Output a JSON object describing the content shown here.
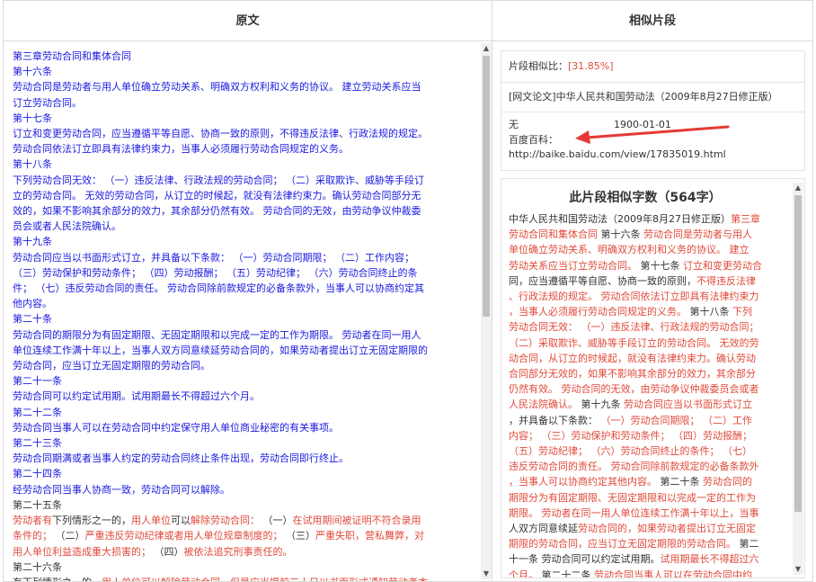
{
  "left": {
    "header": "原文",
    "lines": [
      [
        {
          "t": "第三章劳动合同和集体合同",
          "c": "blue"
        }
      ],
      [
        {
          "t": "第十六条",
          "c": "blue"
        }
      ],
      [
        {
          "t": "劳动合同是劳动者与用人单位确立劳动关系、明确双方权利和义务的协议。 建立劳动关系应当",
          "c": "blue"
        }
      ],
      [
        {
          "t": "订立劳动合同。",
          "c": "blue"
        }
      ],
      [
        {
          "t": "第十七条",
          "c": "blue"
        }
      ],
      [
        {
          "t": "订立和变更劳动合同，应当遵循平等自愿、协商一致的原则，不得违反法律、行政法规的规定。",
          "c": "blue"
        }
      ],
      [
        {
          "t": "劳动合同依法订立即具有法律约束力，当事人必须履行劳动合同规定的义务。",
          "c": "blue"
        }
      ],
      [
        {
          "t": "第十八条",
          "c": "blue"
        }
      ],
      [
        {
          "t": "下列劳动合同无效： （一）违反法律、行政法规的劳动合同； （二）采取欺诈、威胁等手段订",
          "c": "blue"
        }
      ],
      [
        {
          "t": "立的劳动合同。 无效的劳动合同，从订立的时候起，就没有法律约束力。确认劳动合同部分无",
          "c": "blue"
        }
      ],
      [
        {
          "t": "效的，如果不影响其余部分的效力，其余部分仍然有效。 劳动合同的无效，由劳动争议仲裁委",
          "c": "blue"
        }
      ],
      [
        {
          "t": "员会或者人民法院确认。",
          "c": "blue"
        }
      ],
      [
        {
          "t": "第十九条",
          "c": "blue"
        }
      ],
      [
        {
          "t": "劳动合同应当以书面形式订立，并具备以下条款： （一）劳动合同期限； （二）工作内容；",
          "c": "blue"
        }
      ],
      [
        {
          "t": "（三）劳动保护和劳动条件； （四）劳动报酬； （五）劳动纪律； （六）劳动合同终止的条",
          "c": "blue"
        }
      ],
      [
        {
          "t": "件； （七）违反劳动合同的责任。 劳动合同除前款规定的必备条款外，当事人可以协商约定其",
          "c": "blue"
        }
      ],
      [
        {
          "t": "他内容。",
          "c": "blue"
        }
      ],
      [
        {
          "t": "第二十条",
          "c": "blue"
        }
      ],
      [
        {
          "t": "劳动合同的期限分为有固定期限、无固定期限和以完成一定的工作为期限。 劳动者在同一用人",
          "c": "blue"
        }
      ],
      [
        {
          "t": "单位连续工作满十年以上，当事人双方同意续延劳动合同的，如果劳动者提出订立无固定期限的",
          "c": "blue"
        }
      ],
      [
        {
          "t": "劳动合同，应当订立无固定期限的劳动合同。",
          "c": "blue"
        }
      ],
      [
        {
          "t": "第二十一条",
          "c": "blue"
        }
      ],
      [
        {
          "t": "劳动合同可以约定试用期。试用期最长不得超过六个月。",
          "c": "blue"
        }
      ],
      [
        {
          "t": "第二十二条",
          "c": "blue"
        }
      ],
      [
        {
          "t": "劳动合同当事人可以在劳动合同中约定保守用人单位商业秘密的有关事项。",
          "c": "blue"
        }
      ],
      [
        {
          "t": "第二十三条",
          "c": "blue"
        }
      ],
      [
        {
          "t": "劳动合同期满或者当事人约定的劳动合同终止条件出现，劳动合同即行终止。",
          "c": "blue"
        }
      ],
      [
        {
          "t": "第二十四条",
          "c": "blue"
        }
      ],
      [
        {
          "t": "经劳动合同当事人协商一致，劳动合同可以解除。",
          "c": "blue"
        }
      ],
      [
        {
          "t": "第二十五条",
          "c": "dark"
        }
      ],
      [
        {
          "t": "劳动者有",
          "c": "red"
        },
        {
          "t": "下列情形之一的，",
          "c": "dark"
        },
        {
          "t": "用人单位",
          "c": "red"
        },
        {
          "t": "可以",
          "c": "dark"
        },
        {
          "t": "解除劳动合同：",
          "c": "red"
        },
        {
          "t": " （一）",
          "c": "dark"
        },
        {
          "t": "在试用期间被证明不符合录用",
          "c": "red"
        }
      ],
      [
        {
          "t": "条件的；",
          "c": "red"
        },
        {
          "t": " （二）",
          "c": "dark"
        },
        {
          "t": "严重违反劳动纪律或者用人单位规章制度的；",
          "c": "red"
        },
        {
          "t": " （三）",
          "c": "dark"
        },
        {
          "t": "严重失职，营私舞弊，对",
          "c": "red"
        }
      ],
      [
        {
          "t": "用人单位利益造成重大损害的；",
          "c": "red"
        },
        {
          "t": " （四）",
          "c": "dark"
        },
        {
          "t": "被依法追究刑事责任的。",
          "c": "red"
        }
      ],
      [
        {
          "t": "第二十六条",
          "c": "dark"
        }
      ],
      [
        {
          "t": "有下列情形之一的，",
          "c": "dark"
        },
        {
          "t": "用人单位可以解除劳动合同，但是应当提前三十日以书面形式通知劳动者本",
          "c": "red"
        }
      ]
    ]
  },
  "right": {
    "header": "相似片段",
    "ratio_label": "片段相似比：",
    "ratio_value": "[31.85%]",
    "source": "[网文论文]中华人民共和国劳动法（2009年8月27日修正版）",
    "meta_author": "无",
    "meta_date": "1900-01-01",
    "meta_site": "百度百科：",
    "meta_url": "http://baike.baidu.com/view/17835019.html",
    "detail_title": "此片段相似字数（564字）",
    "detail_lines": [
      [
        {
          "t": "中华人民共和国劳动法（2009年8月27日修正版）",
          "c": "dark"
        },
        {
          "t": "第三章",
          "c": "red"
        }
      ],
      [
        {
          "t": "劳动合同和集体合同",
          "c": "red"
        },
        {
          "t": " 第十六条 ",
          "c": "dark"
        },
        {
          "t": "劳动合同",
          "c": "red"
        },
        {
          "t": "是劳动者与用人",
          "c": "red"
        }
      ],
      [
        {
          "t": "单位确立劳动关系、明确双方权利和义务的协议。 建立",
          "c": "red"
        }
      ],
      [
        {
          "t": "劳动关系应当订立劳动合同。",
          "c": "red"
        },
        {
          "t": " 第十七条 ",
          "c": "dark"
        },
        {
          "t": "订立和变更劳动合",
          "c": "red"
        }
      ],
      [
        {
          "t": "同，应当遵循平等自愿、协商一致的原则，",
          "c": "dark"
        },
        {
          "t": "不得违反法律",
          "c": "red"
        }
      ],
      [
        {
          "t": "、行政法规的规定。 劳动合同依法订立即具有法律约束力",
          "c": "red"
        }
      ],
      [
        {
          "t": "，当事人必须履行劳动合同规定的义务。",
          "c": "red"
        },
        {
          "t": " 第十八条 ",
          "c": "dark"
        },
        {
          "t": "下列",
          "c": "red"
        }
      ],
      [
        {
          "t": "劳动合同无效：",
          "c": "red"
        },
        {
          "t": " （一）违反法律、行政法规的劳动合同；",
          "c": "red"
        }
      ],
      [
        {
          "t": " （二）采取欺诈、威胁等手段订立的劳动合同。 无效的劳",
          "c": "red"
        }
      ],
      [
        {
          "t": "动合同，从订立的时候起，就没有法律约束力。确认劳动",
          "c": "red"
        }
      ],
      [
        {
          "t": "合同部分无效的，如果不影响其余部分的效力，其余部分",
          "c": "red"
        }
      ],
      [
        {
          "t": "仍然有效。 劳动合同的无效，由劳动争议仲裁委员会或者",
          "c": "red"
        }
      ],
      [
        {
          "t": "人民法院确认。",
          "c": "red"
        },
        {
          "t": " 第十九条 ",
          "c": "dark"
        },
        {
          "t": "劳动合同应当以书面形式订立",
          "c": "red"
        }
      ],
      [
        {
          "t": "，并具备以下条款：",
          "c": "dark"
        },
        {
          "t": " （一）劳动合同期限； （二）工作",
          "c": "red"
        }
      ],
      [
        {
          "t": "内容； （三）劳动保护和劳动条件； （四）劳动报酬；",
          "c": "red"
        }
      ],
      [
        {
          "t": " （五）劳动纪律； （六）劳动合同终止的条件； （七）",
          "c": "red"
        }
      ],
      [
        {
          "t": "违反劳动合同的责任。 劳动合同除前款规定的必备条款外",
          "c": "red"
        }
      ],
      [
        {
          "t": "，当事人可以协商约定其他内容。",
          "c": "red"
        },
        {
          "t": " 第二十条 ",
          "c": "dark"
        },
        {
          "t": "劳动合同的",
          "c": "red"
        }
      ],
      [
        {
          "t": "期限分为有固定期限、无固定期限和以完成一定的工作为",
          "c": "red"
        }
      ],
      [
        {
          "t": "期限。 劳动者在同一用人单位连续工作满十年以上，当事",
          "c": "red"
        }
      ],
      [
        {
          "t": "人双方同意续延",
          "c": "dark"
        },
        {
          "t": "劳动合同的，如果劳动者提出订立无固定",
          "c": "red"
        }
      ],
      [
        {
          "t": "期限的劳动合同，应当订立无固定期限的劳动合同。",
          "c": "red"
        },
        {
          "t": " 第二",
          "c": "dark"
        }
      ],
      [
        {
          "t": "十一条 劳动合同可以约定试用期。",
          "c": "dark"
        },
        {
          "t": "试用期最长不得超过六",
          "c": "red"
        }
      ],
      [
        {
          "t": "个月。",
          "c": "red"
        },
        {
          "t": " 第二十二条 ",
          "c": "dark"
        },
        {
          "t": "劳动合同当事人可以在劳动合同中约",
          "c": "red"
        }
      ]
    ]
  }
}
